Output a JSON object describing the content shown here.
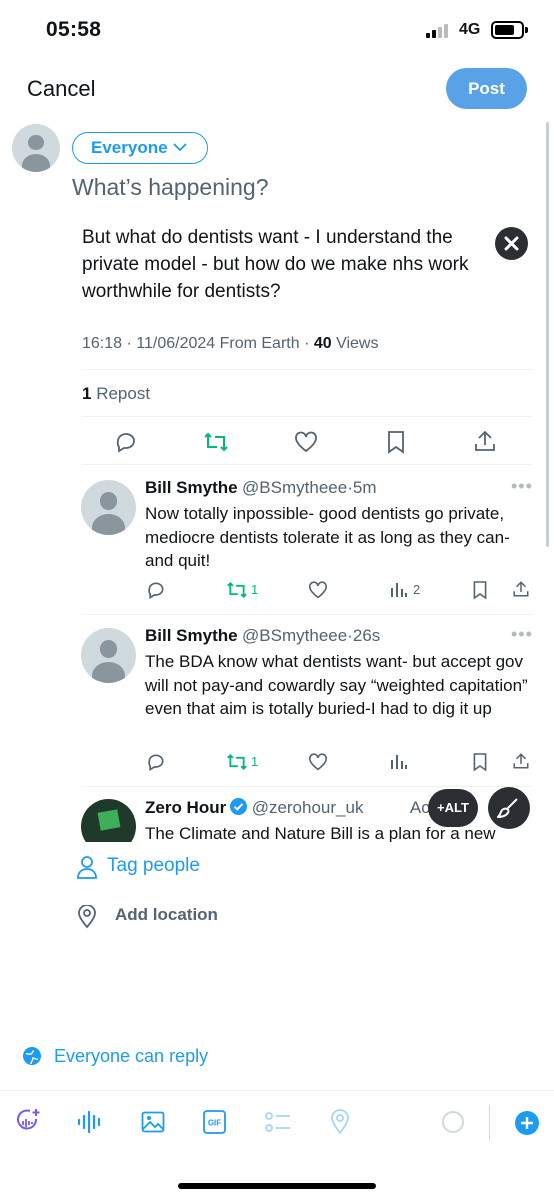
{
  "status_bar": {
    "time": "05:58",
    "network": "4G"
  },
  "header": {
    "cancel_label": "Cancel",
    "post_label": "Post"
  },
  "composer": {
    "audience_label": "Everyone",
    "placeholder": "What’s happening?"
  },
  "quoted_post": {
    "text": "But what do dentists want - I  understand the private model - but how do we make nhs work worthwhile for dentists?",
    "time": "16:18",
    "date": "11/06/2024",
    "source": "From Earth",
    "views_count": "40",
    "views_label": "Views",
    "reposts_count": "1",
    "reposts_label": "Repost"
  },
  "replies": [
    {
      "name": "Bill Smythe",
      "handle": "@BSmytheee",
      "time": "5m",
      "text": "Now totally inpossible- good dentists go private, mediocre dentists tolerate it as long as they can-and quit!",
      "reposts": "1",
      "views": "2"
    },
    {
      "name": "Bill Smythe",
      "handle": "@BSmytheee",
      "time": "26s",
      "text": "The BDA know what dentists want- but accept gov will not pay-and cowardly say “weighted capitation” even that aim is totally buried-I had to dig it up",
      "reposts": "1",
      "views": ""
    },
    {
      "name": "Zero Hour",
      "handle": "@zerohour_uk",
      "time": "Ac",
      "text": "The Climate and Nature Bill is a plan for a new"
    }
  ],
  "media_overlay": {
    "alt_label": "+ALT"
  },
  "options": {
    "tag_people": "Tag people",
    "add_location": "Add location"
  },
  "reply_setting": "Everyone can reply",
  "colors": {
    "accent": "#1d9bf0",
    "post_button": "#5aa2e8",
    "repost_green": "#00ba7c",
    "text_secondary": "#536471"
  },
  "icons": {
    "toolbar": [
      "grok-icon",
      "voice-icon",
      "image-icon",
      "gif-icon",
      "poll-icon",
      "location-icon",
      "progress-circle-icon",
      "add-post-icon"
    ]
  }
}
